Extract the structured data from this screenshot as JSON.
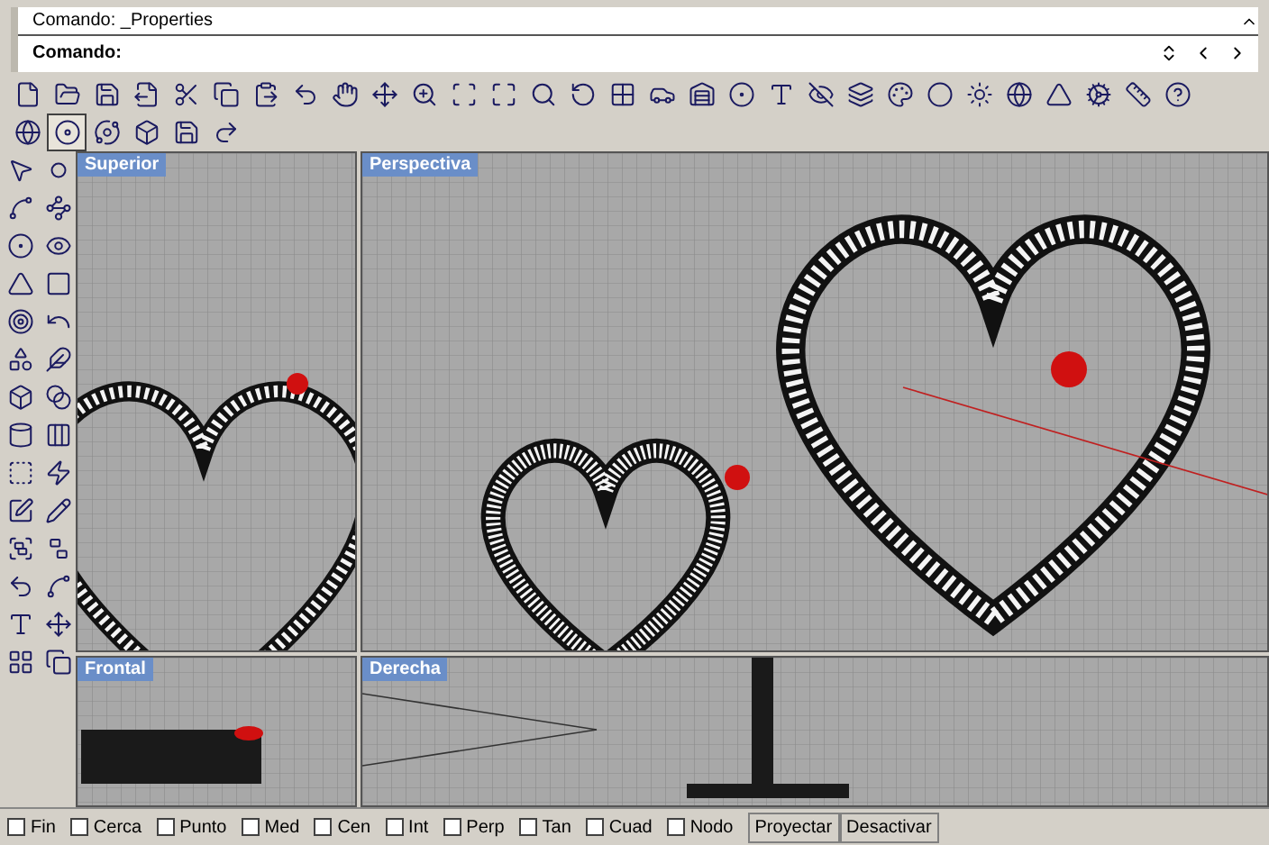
{
  "command": {
    "history": "Comando: _Properties",
    "prompt": "Comando:"
  },
  "viewports": [
    {
      "title": "Superior",
      "kind": "top"
    },
    {
      "title": "Perspectiva",
      "kind": "perspective"
    },
    {
      "title": "Frontal",
      "kind": "front"
    },
    {
      "title": "Derecha",
      "kind": "right"
    }
  ],
  "osnaps": [
    {
      "label": "Fin",
      "checked": false
    },
    {
      "label": "Cerca",
      "checked": false
    },
    {
      "label": "Punto",
      "checked": false
    },
    {
      "label": "Med",
      "checked": false
    },
    {
      "label": "Cen",
      "checked": false
    },
    {
      "label": "Int",
      "checked": false
    },
    {
      "label": "Perp",
      "checked": false
    },
    {
      "label": "Tan",
      "checked": false
    },
    {
      "label": "Cuad",
      "checked": false
    },
    {
      "label": "Nodo",
      "checked": false
    }
  ],
  "status_buttons": [
    "Proyectar",
    "Desactivar"
  ]
}
